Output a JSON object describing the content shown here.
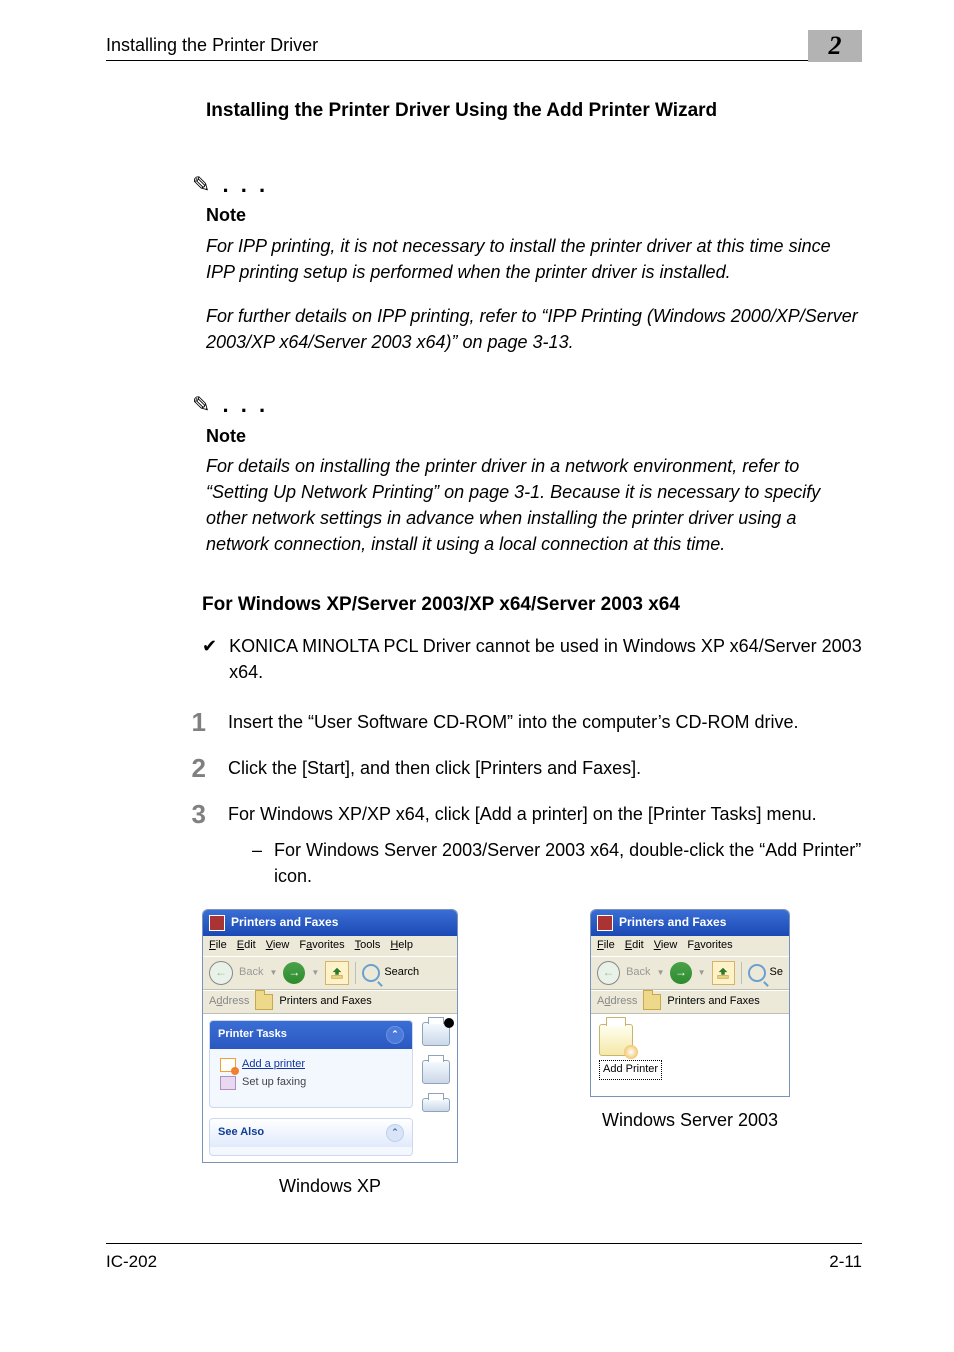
{
  "header": {
    "title": "Installing the Printer Driver",
    "chapter": "2"
  },
  "section_title": "Installing the Printer Driver Using the Add Printer Wizard",
  "note1": {
    "label": "Note",
    "para1": "For IPP printing, it is not necessary to install the printer driver at this time since IPP printing setup is performed when the printer driver is installed.",
    "para2": "For further details on IPP printing, refer to “IPP Printing (Windows 2000/XP/Server 2003/XP x64/Server 2003 x64)” on page 3-13."
  },
  "note2": {
    "label": "Note",
    "para1": "For details on installing the printer driver in a network environment, refer to “Setting Up Network Printing” on page 3-1. Because it is necessary to specify other network settings in advance when installing the printer driver using a network connection, install it using a local connection at this time."
  },
  "subheading": "For Windows XP/Server 2003/XP x64/Server 2003 x64",
  "check_item": "KONICA MINOLTA PCL Driver cannot be used in Windows XP x64/Server 2003 x64.",
  "steps": {
    "1": "Insert the “User Software CD-ROM” into the computer’s CD-ROM drive.",
    "2": "Click the [Start], and then click [Printers and Faxes].",
    "3": "For Windows XP/XP x64, click [Add a printer] on the [Printer Tasks] menu.",
    "3sub": "For Windows Server 2003/Server 2003 x64, double-click the “Add Printer” icon."
  },
  "screenshot_xp": {
    "title": "Printers and Faxes",
    "menus": {
      "file": "File",
      "edit": "Edit",
      "view": "View",
      "fav": "Favorites",
      "tools": "Tools",
      "help": "Help"
    },
    "toolbar": {
      "back_label": "Back",
      "search_label": "Search"
    },
    "address": {
      "label": "Address",
      "value": "Printers and Faxes"
    },
    "panel1": {
      "title": "Printer Tasks",
      "add": "Add a printer",
      "fax": "Set up faxing"
    },
    "panel2": {
      "title": "See Also"
    },
    "caption": "Windows XP"
  },
  "screenshot_srv": {
    "title": "Printers and Faxes",
    "menus": {
      "file": "File",
      "edit": "Edit",
      "view": "View",
      "fav": "Favorites"
    },
    "toolbar": {
      "back_label": "Back",
      "search_suffix": "Se"
    },
    "address": {
      "label": "Address",
      "value": "Printers and Faxes"
    },
    "icon_label": "Add Printer",
    "caption": "Windows Server 2003"
  },
  "footer": {
    "left": "IC-202",
    "right": "2-11"
  }
}
